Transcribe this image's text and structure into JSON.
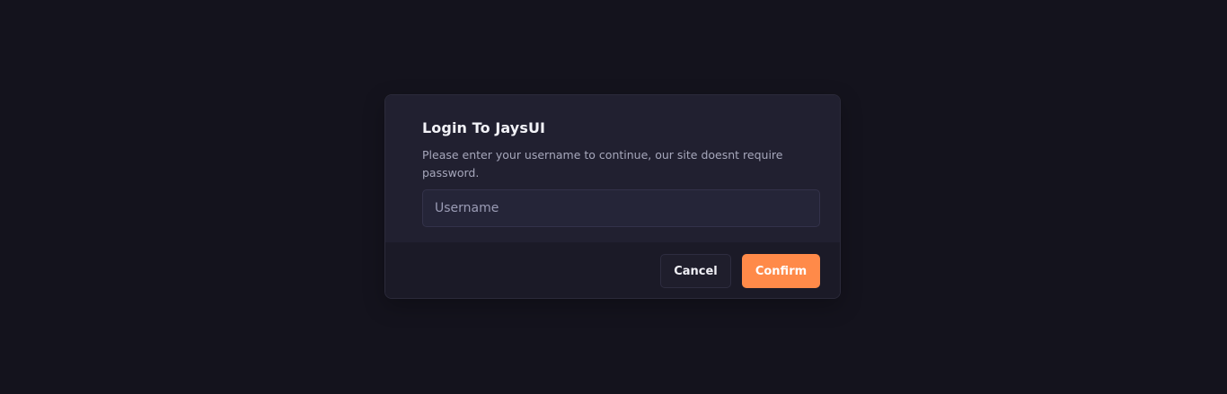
{
  "dialog": {
    "title": "Login To JaysUI",
    "description": "Please enter your username to continue, our site doesnt require password.",
    "username_placeholder": "Username",
    "username_value": "",
    "cancel_label": "Cancel",
    "confirm_label": "Confirm"
  },
  "colors": {
    "page_background": "#14131d",
    "dialog_background": "#212030",
    "footer_background": "#1b1a27",
    "accent": "#ff8a49"
  }
}
